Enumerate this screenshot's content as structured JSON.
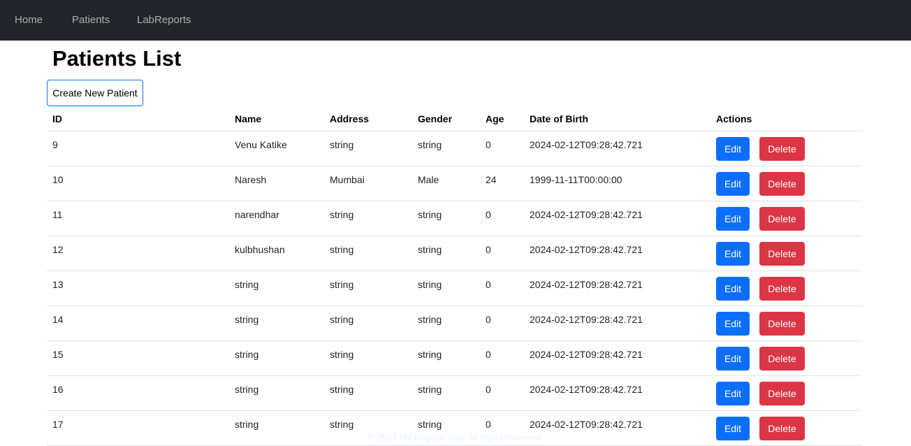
{
  "nav": {
    "items": [
      "Home",
      "Patients",
      "LabReports"
    ]
  },
  "page": {
    "title": "Patients List",
    "create_button": "Create New Patient"
  },
  "table": {
    "headers": [
      "ID",
      "Name",
      "Address",
      "Gender",
      "Age",
      "Date of Birth",
      "Actions"
    ],
    "rows": [
      {
        "id": "9",
        "name": "Venu Katike",
        "address": "string",
        "gender": "string",
        "age": "0",
        "dob": "2024-02-12T09:28:42.721"
      },
      {
        "id": "10",
        "name": "Naresh",
        "address": "Mumbai",
        "gender": "Male",
        "age": "24",
        "dob": "1999-11-11T00:00:00"
      },
      {
        "id": "11",
        "name": "narendhar",
        "address": "string",
        "gender": "string",
        "age": "0",
        "dob": "2024-02-12T09:28:42.721"
      },
      {
        "id": "12",
        "name": "kulbhushan",
        "address": "string",
        "gender": "string",
        "age": "0",
        "dob": "2024-02-12T09:28:42.721"
      },
      {
        "id": "13",
        "name": "string",
        "address": "string",
        "gender": "string",
        "age": "0",
        "dob": "2024-02-12T09:28:42.721"
      },
      {
        "id": "14",
        "name": "string",
        "address": "string",
        "gender": "string",
        "age": "0",
        "dob": "2024-02-12T09:28:42.721"
      },
      {
        "id": "15",
        "name": "string",
        "address": "string",
        "gender": "string",
        "age": "0",
        "dob": "2024-02-12T09:28:42.721"
      },
      {
        "id": "16",
        "name": "string",
        "address": "string",
        "gender": "string",
        "age": "0",
        "dob": "2024-02-12T09:28:42.721"
      },
      {
        "id": "17",
        "name": "string",
        "address": "string",
        "gender": "string",
        "age": "0",
        "dob": "2024-02-12T09:28:42.721"
      }
    ],
    "edit_label": "Edit",
    "delete_label": "Delete"
  },
  "footer": {
    "text": "© 2024 My Angular App. All rights reserved."
  },
  "colors": {
    "navbar": "#212529",
    "primary": "#0d6efd",
    "danger": "#dc3545"
  }
}
